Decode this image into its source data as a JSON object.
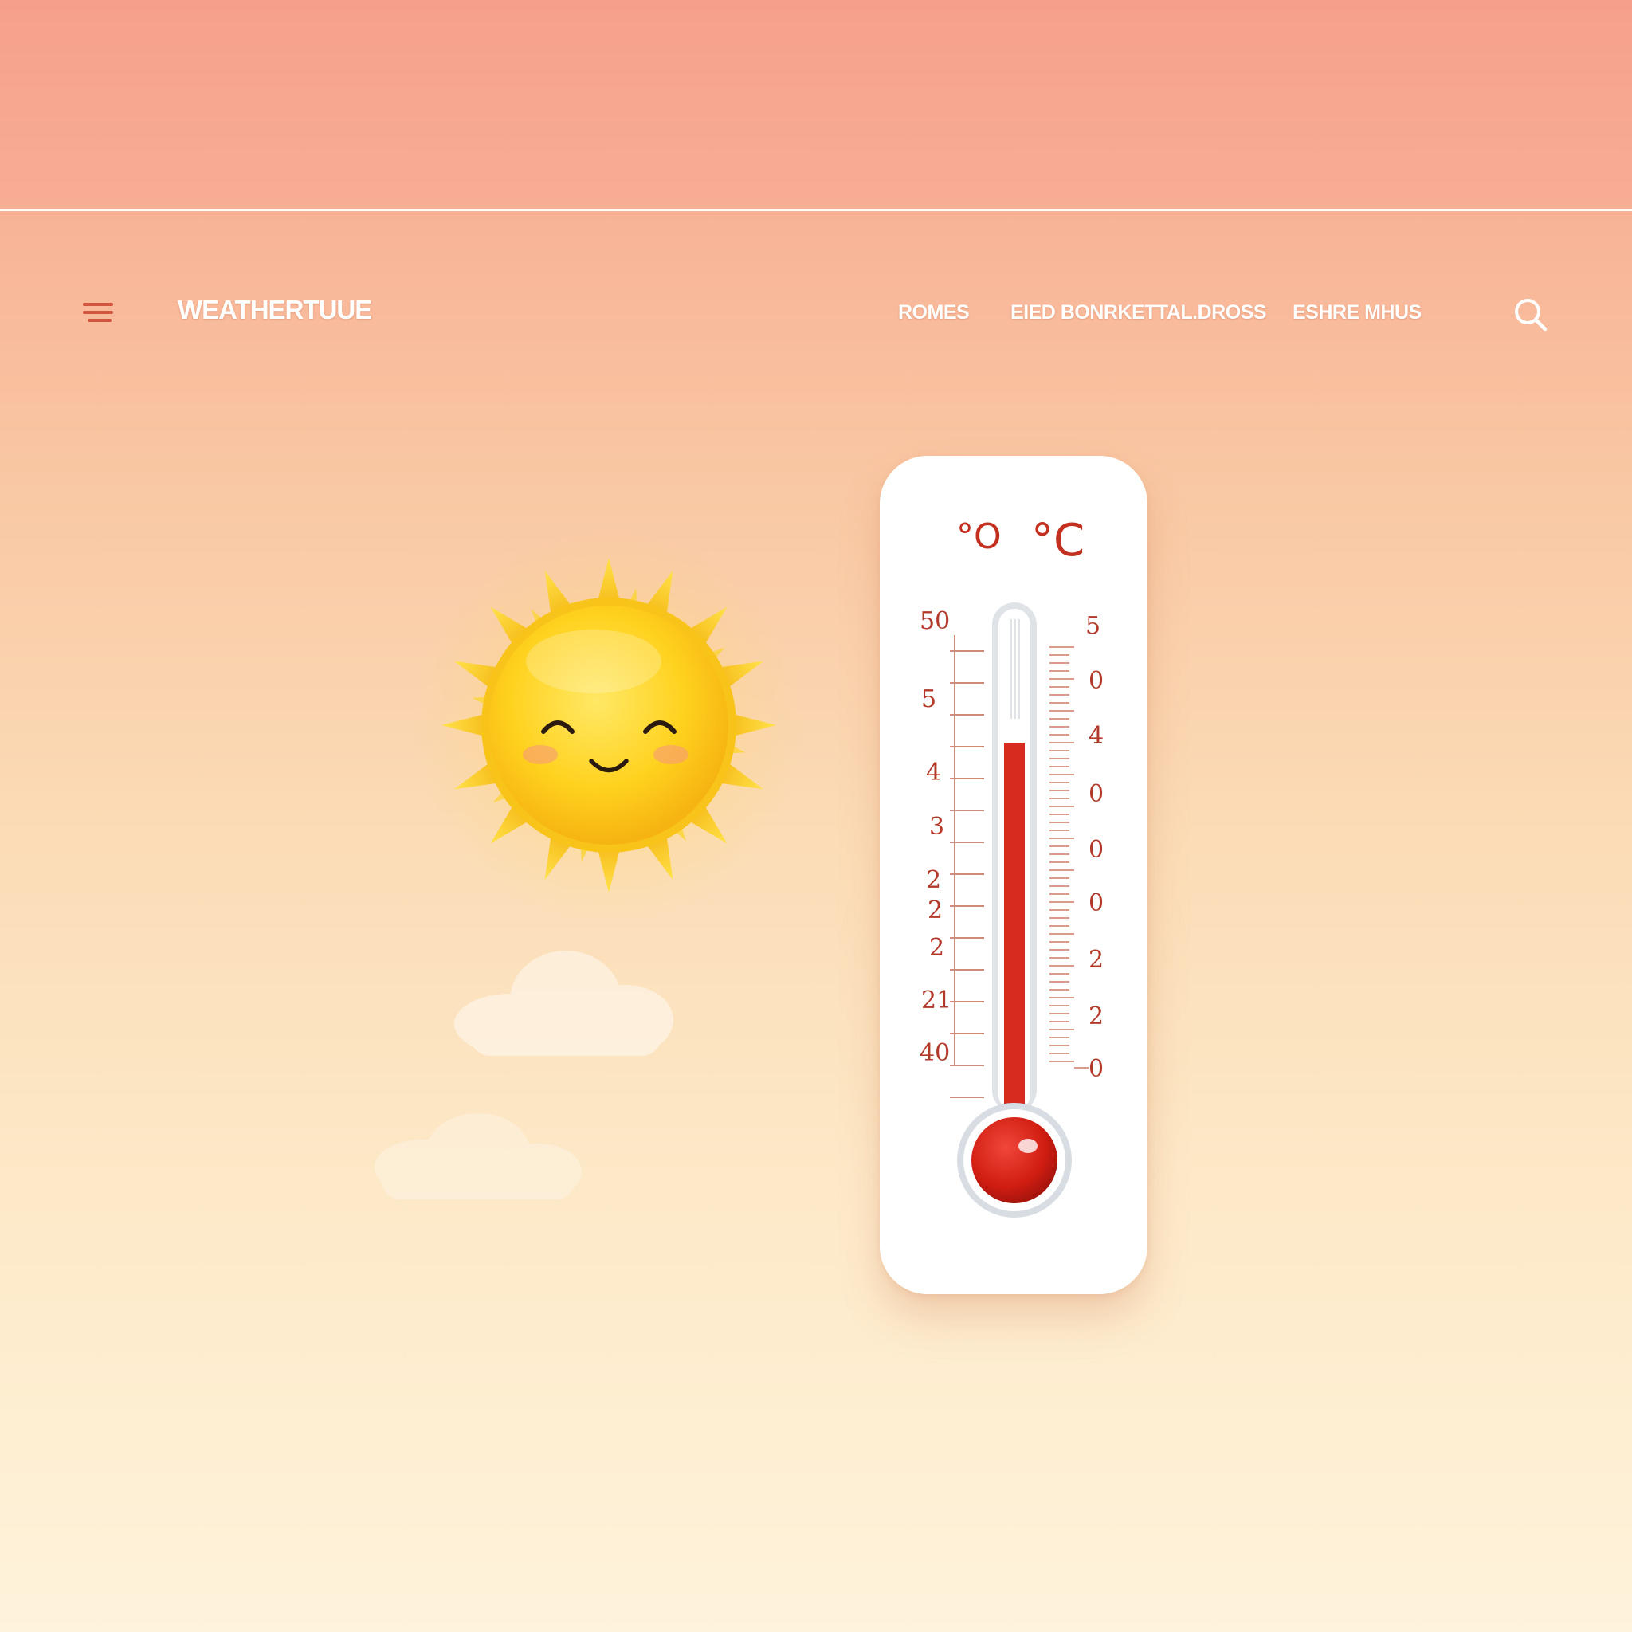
{
  "header": {
    "brand": "WEATHERTUUE",
    "nav": [
      "ROMES",
      "EIED BONRKETTAL.DROSS",
      "ESHRE MHUS"
    ]
  },
  "thermometer": {
    "units": [
      "°O",
      "°C"
    ],
    "left_scale": [
      "50",
      "5",
      "4",
      "3",
      "2",
      "2",
      "2",
      "21",
      "40"
    ],
    "right_scale": [
      "5",
      "0",
      "4",
      "0",
      "0",
      "0",
      "2",
      "2",
      "0"
    ],
    "level_fraction": 0.75,
    "mercury_color": "#d62b1e"
  },
  "colors": {
    "accent": "#d2553f",
    "sun": "#ffd21f",
    "background_top": "#f7a48e",
    "background_bottom": "#fef3db"
  },
  "icons": {
    "menu": "menu-icon",
    "search": "search-icon",
    "sun": "smiling-sun-icon",
    "cloud": "cloud-icon",
    "thermometer": "thermometer-icon"
  }
}
